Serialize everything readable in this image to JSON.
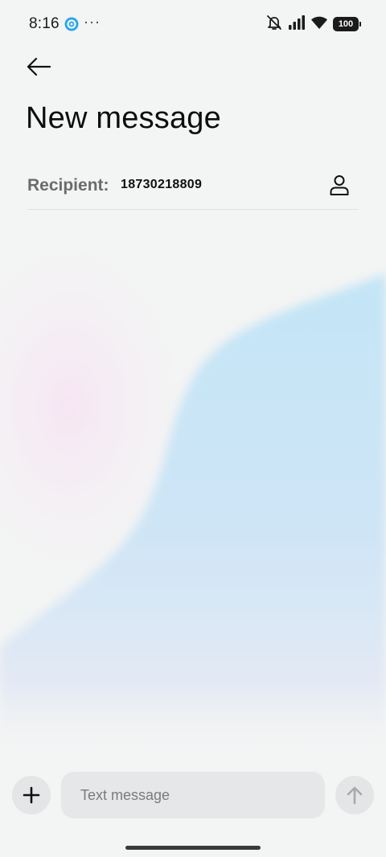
{
  "status_bar": {
    "time": "8:16",
    "more": "···",
    "battery": "100",
    "icons": [
      "app-notification-icon",
      "silent-bell-icon",
      "signal-icon",
      "wifi-icon",
      "battery-icon"
    ]
  },
  "header": {
    "back_icon": "back-arrow-icon",
    "title": "New message"
  },
  "recipient": {
    "label": "Recipient:",
    "value": "18730218809",
    "contact_icon": "contact-person-icon"
  },
  "compose": {
    "attach_icon": "plus-icon",
    "placeholder": "Text message",
    "value": "",
    "send_icon": "send-arrow-icon"
  },
  "colors": {
    "background": "#f3f4f4",
    "wave_blue": "#c7e6f6",
    "wave_pink": "#f7e6f3",
    "app_icon_blue": "#2ea6e6",
    "input_bg": "#e6e7e8"
  }
}
